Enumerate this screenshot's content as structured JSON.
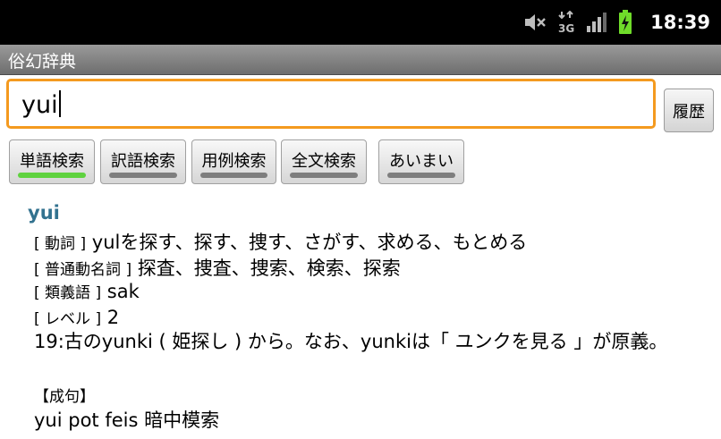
{
  "status_bar": {
    "icons": [
      "mute-icon",
      "3g-icon",
      "signal-icon",
      "battery-charging-icon"
    ],
    "time": "18:39"
  },
  "app": {
    "title": "俗幻辞典"
  },
  "search": {
    "query": "yui",
    "history_label": "履歴"
  },
  "modes": [
    {
      "label": "単語検索",
      "active": true
    },
    {
      "label": "訳語検索",
      "active": false
    },
    {
      "label": "用例検索",
      "active": false
    },
    {
      "label": "全文検索",
      "active": false
    },
    {
      "label": "あいまい",
      "active": false
    }
  ],
  "entry": {
    "word": "yui",
    "lines": [
      {
        "tag": "[ 動詞 ]",
        "text": "yulを探す、探す、捜す、さがす、求める、もとめる"
      },
      {
        "tag": "[ 普通動名詞 ]",
        "text": "探査、捜査、捜索、検索、探索"
      },
      {
        "tag": "[ 類義語 ]",
        "text": "sak"
      },
      {
        "tag": "[ レベル ]",
        "text": "2"
      }
    ],
    "description": "19:古のyunki ( 姫探し ) から。なお、yunkiは「 ユンクを見る 」が原義。",
    "section_heading": "【成句】",
    "phrase": "yui pot feis 暗中模索"
  },
  "colors": {
    "accent": "#f49a1f",
    "word": "#32728f",
    "active_indicator": "#5fd23f"
  }
}
